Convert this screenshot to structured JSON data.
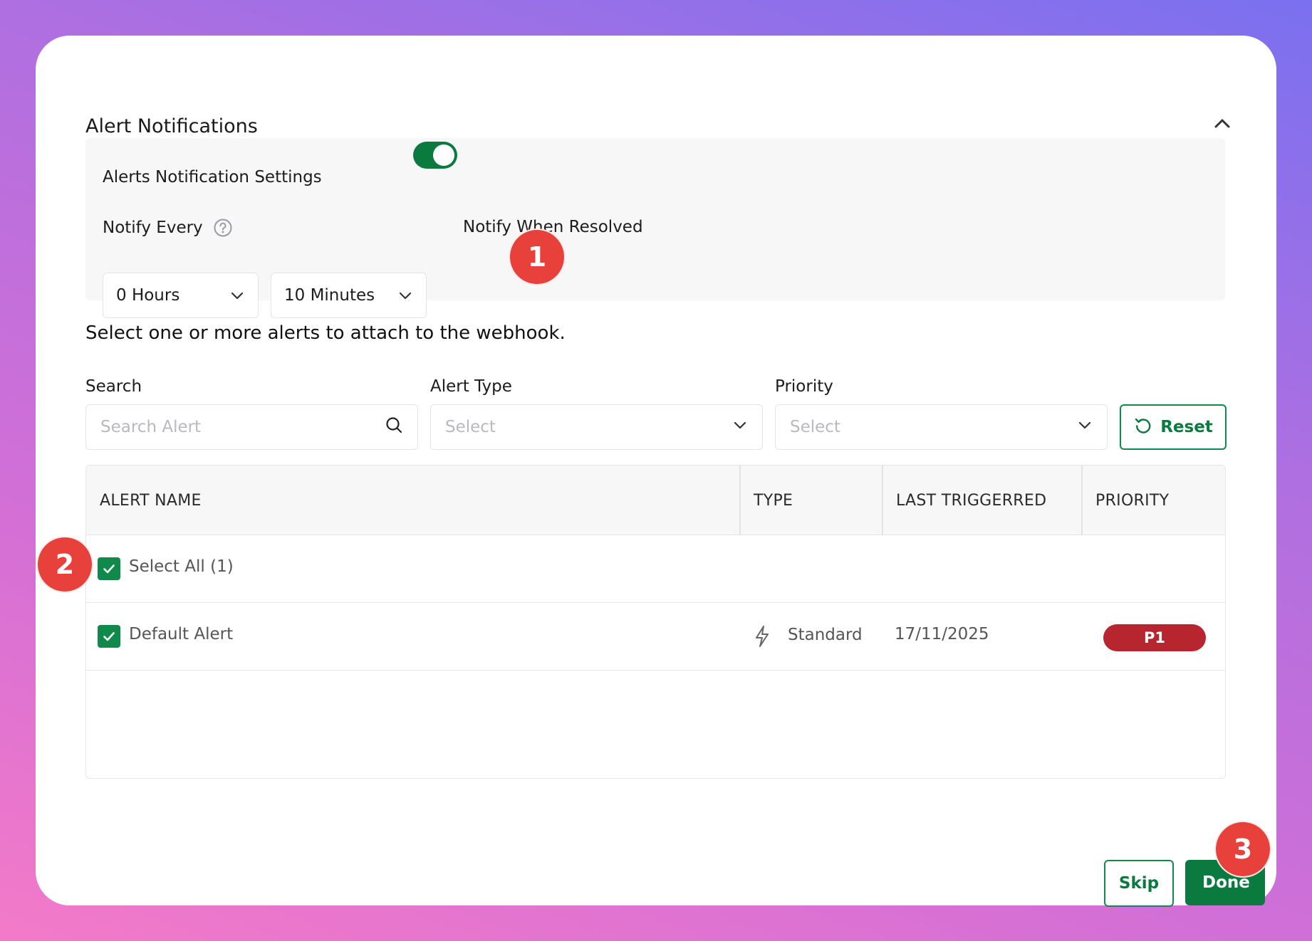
{
  "panel": {
    "title": "Alert Notifications"
  },
  "settings": {
    "title": "Alerts Notification Settings",
    "notify_every_label": "Notify Every",
    "hours_value": "0 Hours",
    "minutes_value": "10 Minutes",
    "notify_resolved_label": "Notify When Resolved",
    "notify_resolved_on": true
  },
  "instructions": "Select one or more alerts to attach to the webhook.",
  "filters": {
    "search_label": "Search",
    "search_placeholder": "Search Alert",
    "alert_type_label": "Alert Type",
    "alert_type_value": "Select",
    "priority_label": "Priority",
    "priority_value": "Select",
    "reset_label": "Reset"
  },
  "table": {
    "columns": [
      "ALERT NAME",
      "TYPE",
      "LAST TRIGGERRED",
      "PRIORITY"
    ],
    "select_all_label": "Select All (1)",
    "rows": [
      {
        "name": "Default Alert",
        "type": "Standard",
        "last_triggered": "17/11/2025",
        "priority": "P1",
        "checked": true
      }
    ]
  },
  "footer": {
    "skip_label": "Skip",
    "done_label": "Done"
  },
  "annotations": [
    "1",
    "2",
    "3"
  ],
  "colors": {
    "accent_green": "#0a7a3e",
    "priority_p1": "#b7262e",
    "annotation_badge": "#e8413c"
  }
}
